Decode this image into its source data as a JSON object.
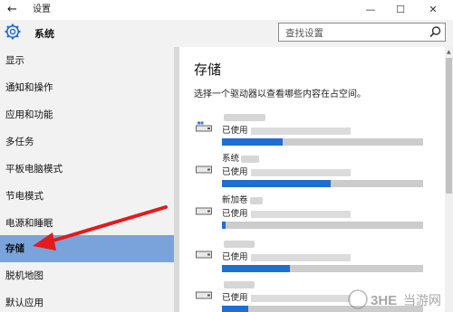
{
  "window": {
    "title": "设置",
    "back_glyph": "←",
    "minimize_glyph": "—",
    "maximize_glyph": "☐",
    "close_glyph": "✕"
  },
  "header": {
    "app_name": "系统",
    "search_placeholder": "查找设置"
  },
  "sidebar": {
    "items": [
      {
        "label": "显示"
      },
      {
        "label": "通知和操作"
      },
      {
        "label": "应用和功能"
      },
      {
        "label": "多任务"
      },
      {
        "label": "平板电脑模式"
      },
      {
        "label": "节电模式"
      },
      {
        "label": "电源和睡眠"
      },
      {
        "label": "存储",
        "selected": true
      },
      {
        "label": "脱机地图"
      },
      {
        "label": "默认应用"
      }
    ]
  },
  "main": {
    "title": "存储",
    "description": "选择一个驱动器以查看哪些内容在占空间。",
    "drives": [
      {
        "name": "",
        "used_label": "已使用",
        "used_fraction": 0.3
      },
      {
        "name": "系统",
        "used_label": "已使用",
        "used_fraction": 0.54
      },
      {
        "name": "新加卷",
        "used_label": "已使用",
        "used_fraction": 0.02
      },
      {
        "name": "",
        "used_label": "已使用",
        "used_fraction": 0.34
      },
      {
        "name": "",
        "used_label": "已使用",
        "used_fraction": 0.13
      }
    ]
  },
  "watermark": {
    "logo_text": "3HE",
    "site_text": "当游网"
  },
  "colors": {
    "accent": "#1f6ed4",
    "selected_nav": "#7aa3dc",
    "annotation_arrow": "#e31b1b"
  }
}
